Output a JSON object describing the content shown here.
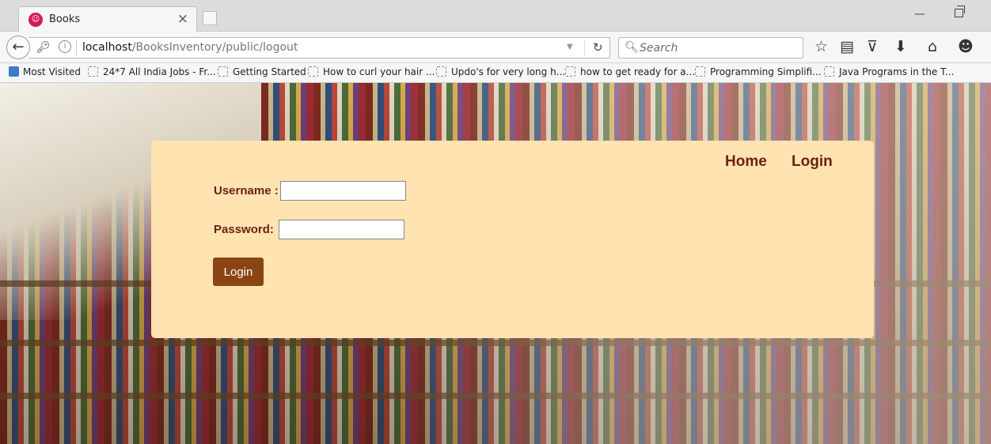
{
  "browser": {
    "tab": {
      "title": "Books",
      "close": "×"
    },
    "url": {
      "host": "localhost",
      "path": "/BooksInventory/public/logout"
    },
    "search": {
      "placeholder": "Search"
    },
    "bookmarks": [
      {
        "label": "Most Visited"
      },
      {
        "label": "24*7 All India Jobs - Fr..."
      },
      {
        "label": "Getting Started"
      },
      {
        "label": "How to curl your hair ..."
      },
      {
        "label": "Updo's for very long h..."
      },
      {
        "label": "how to get ready for a..."
      },
      {
        "label": "Programming Simplifi..."
      },
      {
        "label": "Java Programs in the T..."
      }
    ]
  },
  "page": {
    "nav": {
      "home": "Home",
      "login": "Login"
    },
    "form": {
      "username_label": "Username :",
      "username_value": "",
      "password_label": "Password:",
      "password_value": "",
      "submit_label": "Login"
    }
  },
  "colors": {
    "panel_bg": "#ffe3b1",
    "text_brown": "#6b1f14",
    "button_bg": "#8b4513"
  }
}
